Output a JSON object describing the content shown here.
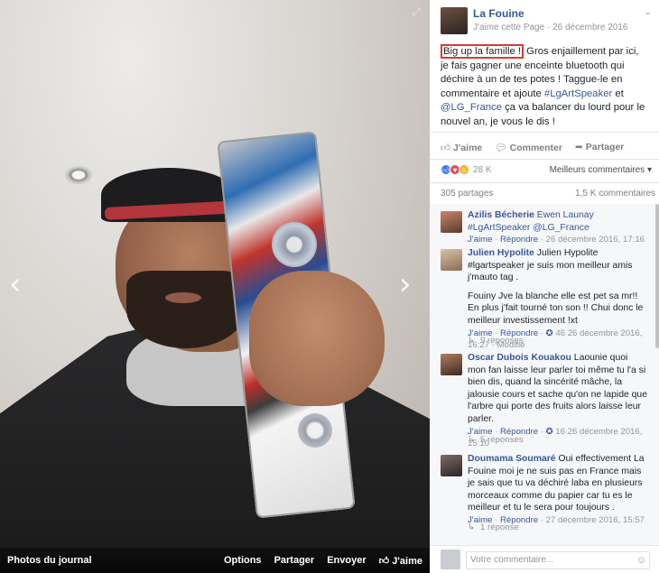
{
  "photo_viewer": {
    "footer_label": "Photos du journal",
    "options": "Options",
    "share": "Partager",
    "send": "Envoyer",
    "like": "J'aime"
  },
  "post": {
    "author": "La Fouine",
    "like_page": "J'aime cette Page",
    "date": "26 décembre 2016",
    "highlight": "Big up la famille !",
    "text_1": " Gros enjaillement par ici, je fais gagner une enceinte bluetooth qui déchire à un de tes potes ! Taggue-le en commentaire et ajoute ",
    "hashtag": "#LgArtSpeaker",
    "text_2": " et ",
    "mention": "@LG_France",
    "text_3": " ça va balancer du lourd pour le nouvel an, je vous le dis !",
    "actions": {
      "like": "J'aime",
      "comment": "Commenter",
      "share": "Partager"
    },
    "reactions_count": "28 K",
    "sort_label": "Meilleurs commentaires",
    "shares": "305 partages",
    "comments_count": "1,5 K commentaires"
  },
  "comments": [
    {
      "author": "Azilis Bécherie",
      "text": " Ewen Launay #LgArtSpeaker @LG_France",
      "like": "J'aime",
      "reply": "Répondre",
      "date": "26 décembre 2016, 17:16"
    },
    {
      "author": "Julien Hypolite",
      "text": " Julien Hypolite #lgartspeaker je suis mon meilleur amis j'mauto tag .",
      "text2": "Fouiny Jve la blanche elle est pet sa mr!! En plus j'fait tourné ton son !! Chui donc le meilleur investissement !xt",
      "like": "J'aime",
      "reply": "Répondre",
      "likes": "46",
      "date": "26 décembre 2016, 16:27",
      "modified": "Modifié",
      "replies": "9 réponses"
    },
    {
      "author": "Oscar Dubois Kouakou",
      "text": " Laounie quoi mon fan laisse leur parler toi même tu l'a si bien dis, quand la sincérité mâche, la jalousie cours et sache qu'on ne lapide que l'arbre qui porte des fruits alors laisse leur parler.",
      "like": "J'aime",
      "reply": "Répondre",
      "likes": "16",
      "date": "26 décembre 2016, 15:10",
      "replies": "5 réponses"
    },
    {
      "author": "Doumama Soumaré",
      "text": " Oui effectivement La Fouine moi je ne suis pas en France mais je sais que tu va déchiré laba en plusieurs morceaux comme du papier car tu es le meilleur et tu le sera pour toujours .",
      "like": "J'aime",
      "reply": "Répondre",
      "date": "27 décembre 2016, 15:57",
      "replies": "1 réponse"
    }
  ],
  "composer": {
    "placeholder": "Votre commentaire..."
  },
  "colors": {
    "link": "#365899",
    "highlight_border": "#d83b33"
  }
}
